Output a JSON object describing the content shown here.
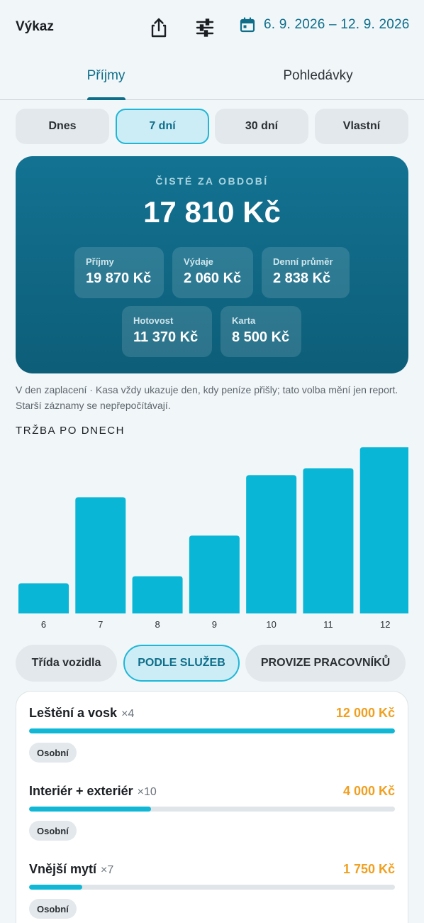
{
  "header": {
    "title": "Výkaz",
    "date_range": "6. 9. 2026 – 12. 9. 2026"
  },
  "icons": {
    "share": "share-icon",
    "filters": "sliders-icon",
    "calendar": "calendar-icon"
  },
  "tabs": [
    {
      "label": "Příjmy",
      "active": true
    },
    {
      "label": "Pohledávky",
      "active": false
    }
  ],
  "periods": [
    {
      "label": "Dnes",
      "active": false
    },
    {
      "label": "7 dní",
      "active": true
    },
    {
      "label": "30 dní",
      "active": false
    },
    {
      "label": "Vlastní",
      "active": false
    }
  ],
  "summary": {
    "net_label": "ČISTÉ ZA OBDOBÍ",
    "net_value": "17 810 Kč",
    "stats": [
      {
        "label": "Příjmy",
        "value": "19 870 Kč"
      },
      {
        "label": "Výdaje",
        "value": "2 060 Kč"
      },
      {
        "label": "Denní průměr",
        "value": "2 838 Kč"
      },
      {
        "label": "Hotovost",
        "value": "11 370 Kč"
      },
      {
        "label": "Karta",
        "value": "8 500 Kč"
      }
    ]
  },
  "note": "V den zaplacení · Kasa vždy ukazuje den, kdy peníze přišly; tato volba mění jen report. Starší záznamy se nepřepočítávají.",
  "revenue_section": {
    "title": "TRŽBA PO DNECH"
  },
  "chart_data": {
    "type": "bar",
    "categories": [
      "6",
      "7",
      "8",
      "9",
      "10",
      "11",
      "12"
    ],
    "values": [
      1300,
      5000,
      1600,
      3350,
      5950,
      6250,
      7150
    ],
    "title": "",
    "xlabel": "",
    "ylabel": "",
    "ylim": [
      0,
      7150
    ],
    "grid": false,
    "bar_color": "#0ab6d6"
  },
  "groupings": [
    {
      "label": "Třída vozidla",
      "active": false
    },
    {
      "label": "PODLE SLUŽEB",
      "active": true
    },
    {
      "label": "PROVIZE PRACOVNÍKŮ",
      "active": false
    }
  ],
  "services": [
    {
      "name": "Leštění a vosk",
      "count": "×4",
      "amount": "12 000 Kč",
      "share": 1.0,
      "tag": "Osobní"
    },
    {
      "name": "Interiér + exteriér",
      "count": "×10",
      "amount": "4 000 Kč",
      "share": 0.333,
      "tag": "Osobní"
    },
    {
      "name": "Vnější mytí",
      "count": "×7",
      "amount": "1 750 Kč",
      "share": 0.146,
      "tag": "Osobní"
    }
  ],
  "colors": {
    "accent": "#0e6e8a",
    "card": "#137292",
    "bar": "#0ab6d6",
    "amount": "#f0a020"
  }
}
